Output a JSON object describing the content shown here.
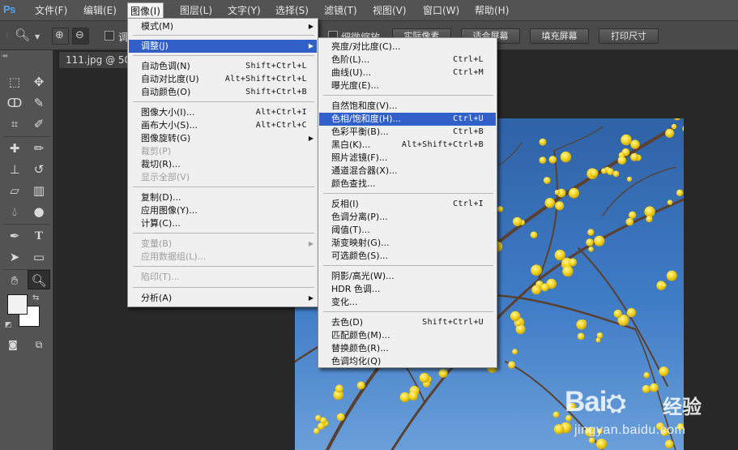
{
  "app": {
    "logo": "Ps"
  },
  "menubar": {
    "items": [
      "文件(F)",
      "编辑(E)",
      "图像(I)",
      "图层(L)",
      "文字(Y)",
      "选择(S)",
      "滤镜(T)",
      "视图(V)",
      "窗口(W)",
      "帮助(H)"
    ],
    "active_index": 2
  },
  "options_bar": {
    "checkbox_a_label": "调",
    "checkbox_b_label": "细微缩放",
    "buttons": [
      "实际像素",
      "适合屏幕",
      "填充屏幕",
      "打印尺寸"
    ]
  },
  "document": {
    "tab_title": "111.jpg @ 50"
  },
  "image_menu": [
    {
      "label": "模式(M)",
      "shortcut": "",
      "submenu": true,
      "disabled": false
    },
    {
      "label": "调整(J)",
      "shortcut": "",
      "submenu": true,
      "disabled": false,
      "highlighted": true
    },
    {
      "label": "自动色调(N)",
      "shortcut": "Shift+Ctrl+L"
    },
    {
      "label": "自动对比度(U)",
      "shortcut": "Alt+Shift+Ctrl+L"
    },
    {
      "label": "自动颜色(O)",
      "shortcut": "Shift+Ctrl+B"
    },
    {
      "label": "图像大小(I)...",
      "shortcut": "Alt+Ctrl+I"
    },
    {
      "label": "画布大小(S)...",
      "shortcut": "Alt+Ctrl+C"
    },
    {
      "label": "图像旋转(G)",
      "shortcut": "",
      "submenu": true
    },
    {
      "label": "裁剪(P)",
      "shortcut": "",
      "disabled": true
    },
    {
      "label": "裁切(R)...",
      "shortcut": ""
    },
    {
      "label": "显示全部(V)",
      "shortcut": "",
      "disabled": true
    },
    {
      "label": "复制(D)...",
      "shortcut": ""
    },
    {
      "label": "应用图像(Y)...",
      "shortcut": ""
    },
    {
      "label": "计算(C)...",
      "shortcut": ""
    },
    {
      "label": "变量(B)",
      "shortcut": "",
      "submenu": true,
      "disabled": true
    },
    {
      "label": "应用数据组(L)...",
      "shortcut": "",
      "disabled": true
    },
    {
      "label": "陷印(T)...",
      "shortcut": "",
      "disabled": true
    },
    {
      "label": "分析(A)",
      "shortcut": "",
      "submenu": true
    }
  ],
  "adjust_menu": [
    {
      "label": "亮度/对比度(C)...",
      "shortcut": ""
    },
    {
      "label": "色阶(L)...",
      "shortcut": "Ctrl+L"
    },
    {
      "label": "曲线(U)...",
      "shortcut": "Ctrl+M"
    },
    {
      "label": "曝光度(E)...",
      "shortcut": ""
    },
    {
      "label": "自然饱和度(V)...",
      "shortcut": ""
    },
    {
      "label": "色相/饱和度(H)...",
      "shortcut": "Ctrl+U",
      "highlighted": true
    },
    {
      "label": "色彩平衡(B)...",
      "shortcut": "Ctrl+B"
    },
    {
      "label": "黑白(K)...",
      "shortcut": "Alt+Shift+Ctrl+B"
    },
    {
      "label": "照片滤镜(F)...",
      "shortcut": ""
    },
    {
      "label": "通道混合器(X)...",
      "shortcut": ""
    },
    {
      "label": "颜色查找...",
      "shortcut": ""
    },
    {
      "label": "反相(I)",
      "shortcut": "Ctrl+I"
    },
    {
      "label": "色调分离(P)...",
      "shortcut": ""
    },
    {
      "label": "阈值(T)...",
      "shortcut": ""
    },
    {
      "label": "渐变映射(G)...",
      "shortcut": ""
    },
    {
      "label": "可选颜色(S)...",
      "shortcut": ""
    },
    {
      "label": "阴影/高光(W)...",
      "shortcut": ""
    },
    {
      "label": "HDR 色调...",
      "shortcut": ""
    },
    {
      "label": "变化...",
      "shortcut": ""
    },
    {
      "label": "去色(D)",
      "shortcut": "Shift+Ctrl+U"
    },
    {
      "label": "匹配颜色(M)...",
      "shortcut": ""
    },
    {
      "label": "替换颜色(R)...",
      "shortcut": ""
    },
    {
      "label": "色调均化(Q)",
      "shortcut": ""
    }
  ],
  "watermark": {
    "brand_left": "Bai",
    "brand_right": "经验",
    "url": "jingyan.baidu.com"
  },
  "colors": {
    "menu_highlight": "#3060c8",
    "foreground_swatch": "#f2f2f2",
    "background_swatch": "#ffffff",
    "sky": "#3f7cc6",
    "blossom": "#f2d21a"
  }
}
